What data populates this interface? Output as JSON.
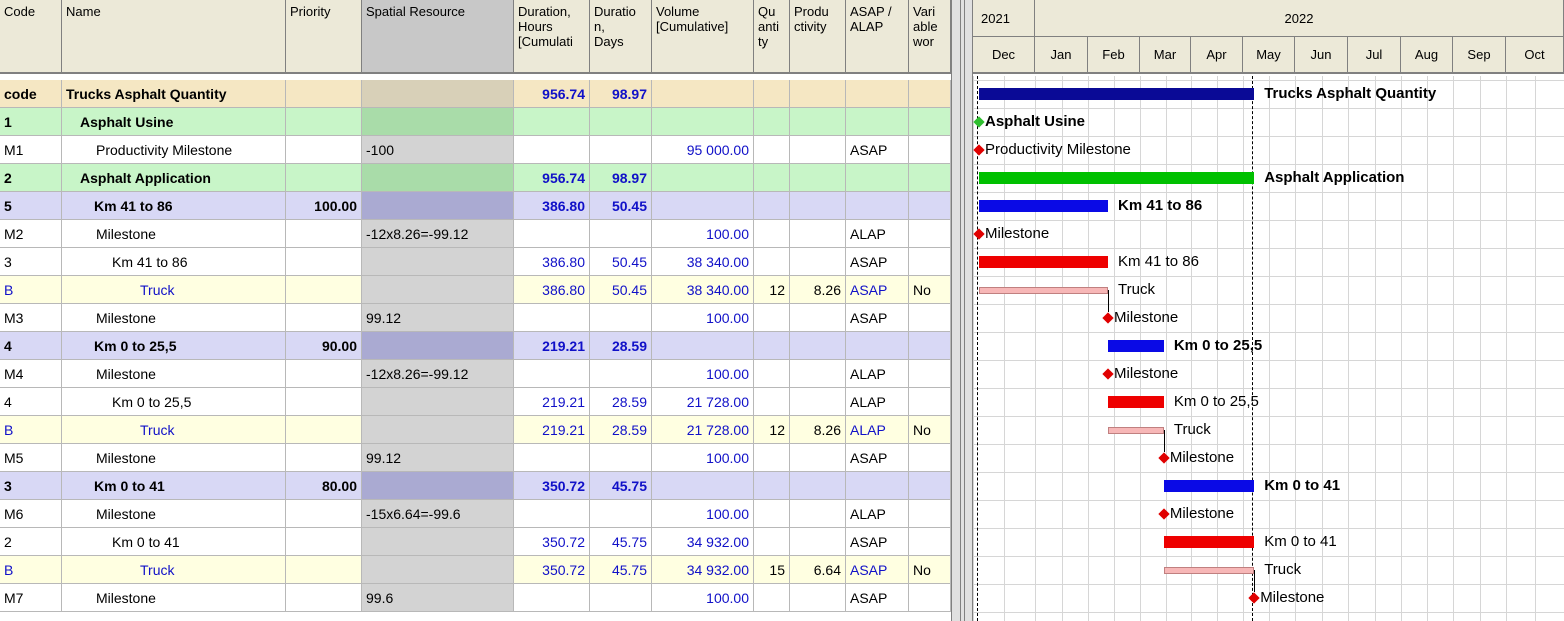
{
  "columns": [
    {
      "key": "code",
      "label": "Code"
    },
    {
      "key": "name",
      "label": "Name"
    },
    {
      "key": "priority",
      "label": "Priority"
    },
    {
      "key": "spatial",
      "label": "Spatial Resource"
    },
    {
      "key": "hours",
      "label": "Duration,\nHours\n[Cumulati"
    },
    {
      "key": "days",
      "label": "Duratio\nn,\nDays"
    },
    {
      "key": "volume",
      "label": "Volume\n[Cumulative]"
    },
    {
      "key": "qty",
      "label": "Qu\nanti\nty"
    },
    {
      "key": "prod",
      "label": "Produ\nctivity"
    },
    {
      "key": "asap",
      "label": "ASAP /\nALAP"
    },
    {
      "key": "var",
      "label": "Vari\nable\nwor"
    }
  ],
  "rows": [
    {
      "type": "project",
      "code": "code",
      "name": "Trucks Asphalt Quantity",
      "priority": "",
      "spatial": "",
      "hours": "956.74",
      "days": "98.97",
      "volume": "",
      "qty": "",
      "prod": "",
      "asap": "",
      "var": ""
    },
    {
      "type": "group",
      "code": "1",
      "name": "Asphalt Usine",
      "priority": "",
      "spatial": "",
      "hours": "",
      "days": "",
      "volume": "",
      "qty": "",
      "prod": "",
      "asap": "",
      "var": ""
    },
    {
      "type": "milestone",
      "code": "M1",
      "name": "Productivity Milestone",
      "priority": "",
      "spatial": "-100",
      "hours": "",
      "days": "",
      "volume": "95 000.00",
      "qty": "",
      "prod": "",
      "asap": "ASAP",
      "var": ""
    },
    {
      "type": "group",
      "code": "2",
      "name": "Asphalt Application",
      "priority": "",
      "spatial": "",
      "hours": "956.74",
      "days": "98.97",
      "volume": "",
      "qty": "",
      "prod": "",
      "asap": "",
      "var": ""
    },
    {
      "type": "sub",
      "code": "5",
      "name": "Km 41 to 86",
      "priority": "100.00",
      "spatial": "",
      "hours": "386.80",
      "days": "50.45",
      "volume": "",
      "qty": "",
      "prod": "",
      "asap": "",
      "var": ""
    },
    {
      "type": "milestone",
      "code": "M2",
      "name": "Milestone",
      "priority": "",
      "spatial": "-12x8.26=-99.12",
      "hours": "",
      "days": "",
      "volume": "100.00",
      "qty": "",
      "prod": "",
      "asap": "ALAP",
      "var": ""
    },
    {
      "type": "task",
      "code": "3",
      "name": "Km 41 to 86",
      "priority": "",
      "spatial": "",
      "hours": "386.80",
      "days": "50.45",
      "volume": "38 340.00",
      "qty": "",
      "prod": "",
      "asap": "ASAP",
      "var": ""
    },
    {
      "type": "resource",
      "code": "B",
      "name": "Truck",
      "priority": "",
      "spatial": "",
      "hours": "386.80",
      "days": "50.45",
      "volume": "38 340.00",
      "qty": "12",
      "prod": "8.26",
      "asap": "ASAP",
      "var": "No"
    },
    {
      "type": "milestone",
      "code": "M3",
      "name": "Milestone",
      "priority": "",
      "spatial": "99.12",
      "hours": "",
      "days": "",
      "volume": "100.00",
      "qty": "",
      "prod": "",
      "asap": "ASAP",
      "var": ""
    },
    {
      "type": "sub",
      "code": "4",
      "name": "Km 0 to 25,5",
      "priority": "90.00",
      "spatial": "",
      "hours": "219.21",
      "days": "28.59",
      "volume": "",
      "qty": "",
      "prod": "",
      "asap": "",
      "var": ""
    },
    {
      "type": "milestone",
      "code": "M4",
      "name": "Milestone",
      "priority": "",
      "spatial": "-12x8.26=-99.12",
      "hours": "",
      "days": "",
      "volume": "100.00",
      "qty": "",
      "prod": "",
      "asap": "ALAP",
      "var": ""
    },
    {
      "type": "task",
      "code": "4",
      "name": "Km 0 to 25,5",
      "priority": "",
      "spatial": "",
      "hours": "219.21",
      "days": "28.59",
      "volume": "21 728.00",
      "qty": "",
      "prod": "",
      "asap": "ALAP",
      "var": ""
    },
    {
      "type": "resource",
      "code": "B",
      "name": "Truck",
      "priority": "",
      "spatial": "",
      "hours": "219.21",
      "days": "28.59",
      "volume": "21 728.00",
      "qty": "12",
      "prod": "8.26",
      "asap": "ALAP",
      "var": "No"
    },
    {
      "type": "milestone",
      "code": "M5",
      "name": "Milestone",
      "priority": "",
      "spatial": "99.12",
      "hours": "",
      "days": "",
      "volume": "100.00",
      "qty": "",
      "prod": "",
      "asap": "ASAP",
      "var": ""
    },
    {
      "type": "sub",
      "code": "3",
      "name": "Km 0 to 41",
      "priority": "80.00",
      "spatial": "",
      "hours": "350.72",
      "days": "45.75",
      "volume": "",
      "qty": "",
      "prod": "",
      "asap": "",
      "var": ""
    },
    {
      "type": "milestone",
      "code": "M6",
      "name": "Milestone",
      "priority": "",
      "spatial": "-15x6.64=-99.6",
      "hours": "",
      "days": "",
      "volume": "100.00",
      "qty": "",
      "prod": "",
      "asap": "ALAP",
      "var": ""
    },
    {
      "type": "task",
      "code": "2",
      "name": "Km 0 to 41",
      "priority": "",
      "spatial": "",
      "hours": "350.72",
      "days": "45.75",
      "volume": "34 932.00",
      "qty": "",
      "prod": "",
      "asap": "ASAP",
      "var": ""
    },
    {
      "type": "resource",
      "code": "B",
      "name": "Truck",
      "priority": "",
      "spatial": "",
      "hours": "350.72",
      "days": "45.75",
      "volume": "34 932.00",
      "qty": "15",
      "prod": "6.64",
      "asap": "ASAP",
      "var": "No"
    },
    {
      "type": "milestone",
      "code": "M7",
      "name": "Milestone",
      "priority": "",
      "spatial": "99.6",
      "hours": "",
      "days": "",
      "volume": "100.00",
      "qty": "",
      "prod": "",
      "asap": "ASAP",
      "var": ""
    }
  ],
  "gantt": {
    "years": [
      {
        "label": "2021",
        "months": 1
      },
      {
        "label": "2022",
        "months": 10
      }
    ],
    "months": [
      "Dec",
      "Jan",
      "Feb",
      "Mar",
      "Apr",
      "May",
      "Jun",
      "Jul",
      "Aug",
      "Sep",
      "Oct"
    ],
    "cutoff_month": 5.1,
    "rows": [
      {
        "kind": "summary",
        "color": "#0a0a96",
        "start": 0,
        "end": 5.1,
        "label": "Trucks Asphalt Quantity",
        "bold": true
      },
      {
        "kind": "milestone",
        "color": "#2fbf2f",
        "at": 0,
        "label": "Asphalt Usine",
        "bold": true
      },
      {
        "kind": "milestone",
        "color": "#e00000",
        "at": 0,
        "label": "Productivity Milestone",
        "bold": false
      },
      {
        "kind": "summary",
        "color": "#00c000",
        "start": 0,
        "end": 5.1,
        "label": "Asphalt Application",
        "bold": true
      },
      {
        "kind": "summary",
        "color": "#0a0ae6",
        "start": 0,
        "end": 2.27,
        "label": "Km 41 to 86",
        "bold": true
      },
      {
        "kind": "milestone",
        "color": "#e00000",
        "at": 0,
        "label": "Milestone",
        "bold": false
      },
      {
        "kind": "task",
        "color": "#ee0000",
        "start": 0,
        "end": 2.27,
        "label": "Km 41 to 86",
        "bold": false
      },
      {
        "kind": "resource",
        "color": "#f7b7b7",
        "start": 0,
        "end": 2.27,
        "label": "Truck",
        "bold": false
      },
      {
        "kind": "milestone",
        "color": "#e00000",
        "at": 2.27,
        "label": "Milestone",
        "bold": false
      },
      {
        "kind": "summary",
        "color": "#0a0ae6",
        "start": 2.27,
        "end": 3.35,
        "label": "Km 0 to 25,5",
        "bold": true
      },
      {
        "kind": "milestone",
        "color": "#e00000",
        "at": 2.27,
        "label": "Milestone",
        "bold": false
      },
      {
        "kind": "task",
        "color": "#ee0000",
        "start": 2.27,
        "end": 3.35,
        "label": "Km 0 to 25,5",
        "bold": false
      },
      {
        "kind": "resource",
        "color": "#f7b7b7",
        "start": 2.27,
        "end": 3.35,
        "label": "Truck",
        "bold": false
      },
      {
        "kind": "milestone",
        "color": "#e00000",
        "at": 3.35,
        "label": "Milestone",
        "bold": false
      },
      {
        "kind": "summary",
        "color": "#0a0ae6",
        "start": 3.35,
        "end": 5.1,
        "label": "Km 0 to 41",
        "bold": true
      },
      {
        "kind": "milestone",
        "color": "#e00000",
        "at": 3.35,
        "label": "Milestone",
        "bold": false
      },
      {
        "kind": "task",
        "color": "#ee0000",
        "start": 3.35,
        "end": 5.1,
        "label": "Km 0 to 41",
        "bold": false
      },
      {
        "kind": "resource",
        "color": "#f7b7b7",
        "start": 3.35,
        "end": 5.1,
        "label": "Truck",
        "bold": false
      },
      {
        "kind": "milestone",
        "color": "#e00000",
        "at": 5.1,
        "label": "Milestone",
        "bold": false
      }
    ]
  },
  "colors": {
    "project_bg": "#f5e7c3",
    "group_bg": "#c8f5c8",
    "sub_bg": "#d8d8f5",
    "resource_bg": "#ffffe1",
    "spatial_bg": "#d3d3d3",
    "link_blue": "#1010c8"
  }
}
